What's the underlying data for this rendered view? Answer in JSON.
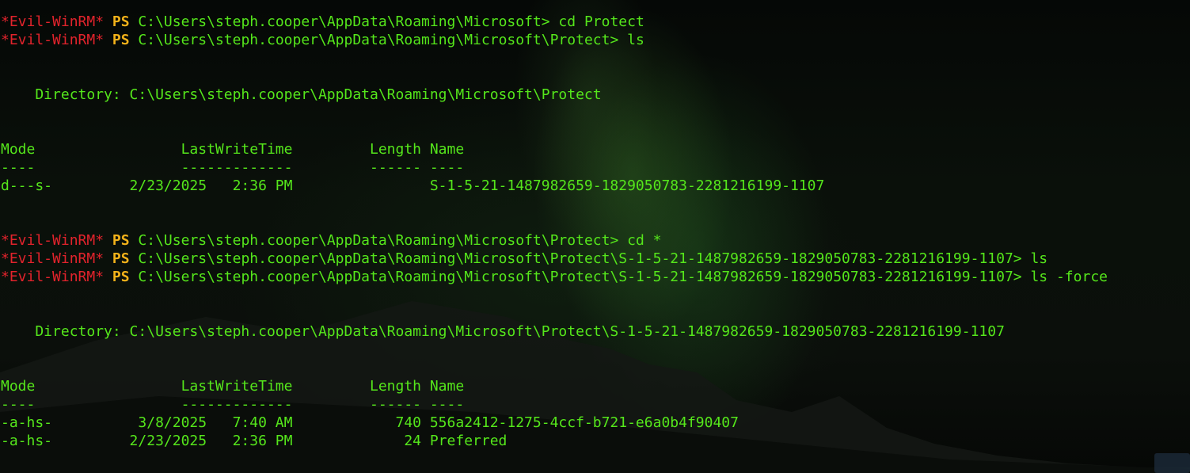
{
  "colors": {
    "prefix": "#e2232c",
    "ps": "#f3b21a",
    "text": "#55e61b"
  },
  "prompts": [
    {
      "prefix": "*Evil-WinRM*",
      "ps": "PS",
      "path_cmd": "C:\\Users\\steph.cooper\\AppData\\Roaming\\Microsoft> cd Protect"
    },
    {
      "prefix": "*Evil-WinRM*",
      "ps": "PS",
      "path_cmd": "C:\\Users\\steph.cooper\\AppData\\Roaming\\Microsoft\\Protect> ls"
    },
    {
      "prefix": "*Evil-WinRM*",
      "ps": "PS",
      "path_cmd": "C:\\Users\\steph.cooper\\AppData\\Roaming\\Microsoft\\Protect> cd *"
    },
    {
      "prefix": "*Evil-WinRM*",
      "ps": "PS",
      "path_cmd": "C:\\Users\\steph.cooper\\AppData\\Roaming\\Microsoft\\Protect\\S-1-5-21-1487982659-1829050783-2281216199-1107> ls"
    },
    {
      "prefix": "*Evil-WinRM*",
      "ps": "PS",
      "path_cmd": "C:\\Users\\steph.cooper\\AppData\\Roaming\\Microsoft\\Protect\\S-1-5-21-1487982659-1829050783-2281216199-1107> ls -force"
    }
  ],
  "listing1": {
    "directory": "    Directory: C:\\Users\\steph.cooper\\AppData\\Roaming\\Microsoft\\Protect",
    "header": "Mode                 LastWriteTime         Length Name",
    "separator": "----                 -------------         ------ ----",
    "rows": [
      "d---s-         2/23/2025   2:36 PM                S-1-5-21-1487982659-1829050783-2281216199-1107"
    ]
  },
  "listing2": {
    "directory": "    Directory: C:\\Users\\steph.cooper\\AppData\\Roaming\\Microsoft\\Protect\\S-1-5-21-1487982659-1829050783-2281216199-1107",
    "header": "Mode                 LastWriteTime         Length Name",
    "separator": "----                 -------------         ------ ----",
    "rows": [
      "-a-hs-          3/8/2025   7:40 AM            740 556a2412-1275-4ccf-b721-e6a0b4f90407",
      "-a-hs-         2/23/2025   2:36 PM             24 Preferred"
    ]
  }
}
